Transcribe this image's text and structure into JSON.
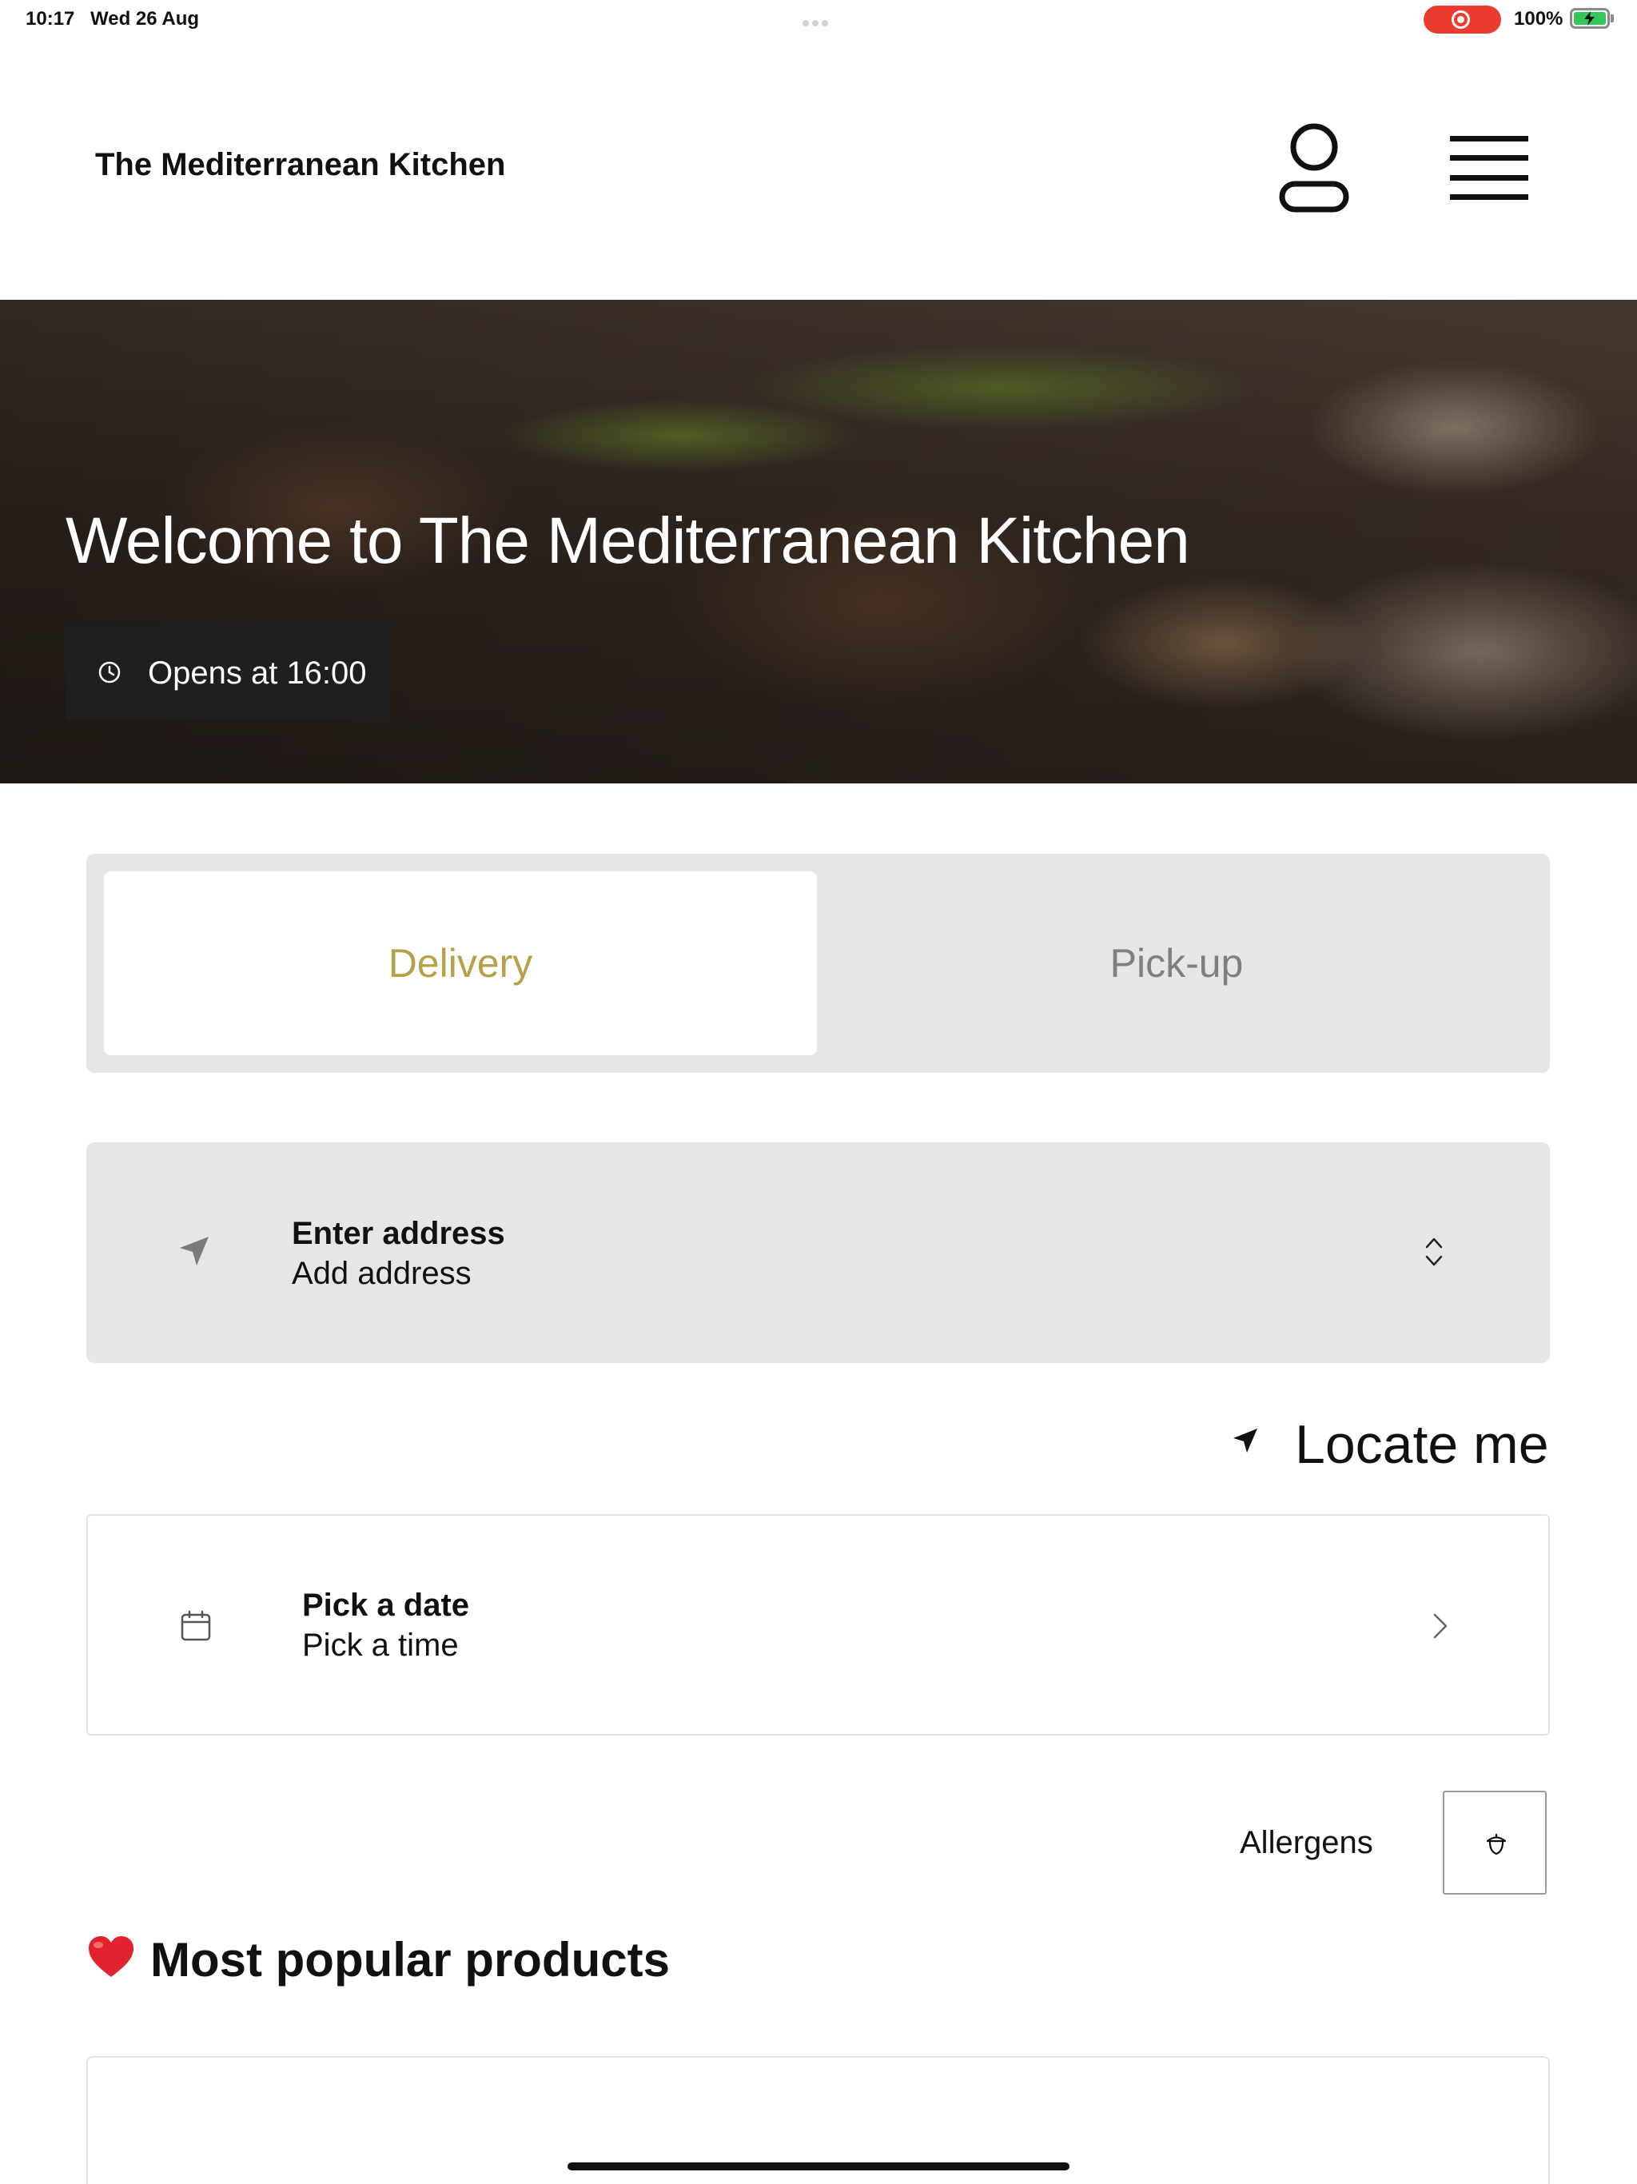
{
  "status_bar": {
    "time": "10:17",
    "date": "Wed 26 Aug",
    "battery": "100%"
  },
  "header": {
    "brand": "The Mediterranean Kitchen",
    "user_icon": "user-icon",
    "menu_icon": "hamburger-menu-icon"
  },
  "hero": {
    "title": "Welcome to The Mediterranean Kitchen",
    "hours": "Opens at 16:00"
  },
  "order_type": {
    "options": [
      {
        "label": "Delivery",
        "selected": true
      },
      {
        "label": "Pick-up",
        "selected": false
      }
    ]
  },
  "address": {
    "title": "Enter address",
    "subtitle": "Add address"
  },
  "locate": {
    "label": "Locate me"
  },
  "schedule": {
    "title": "Pick a date",
    "subtitle": "Pick a time"
  },
  "allergens": {
    "label": "Allergens"
  },
  "popular": {
    "emoji": "❤️",
    "title": "Most popular products"
  },
  "colors": {
    "accent": "#b6a04a",
    "panel": "#e6e6e6",
    "recording": "#ea3b2e",
    "battery": "#34c759"
  }
}
